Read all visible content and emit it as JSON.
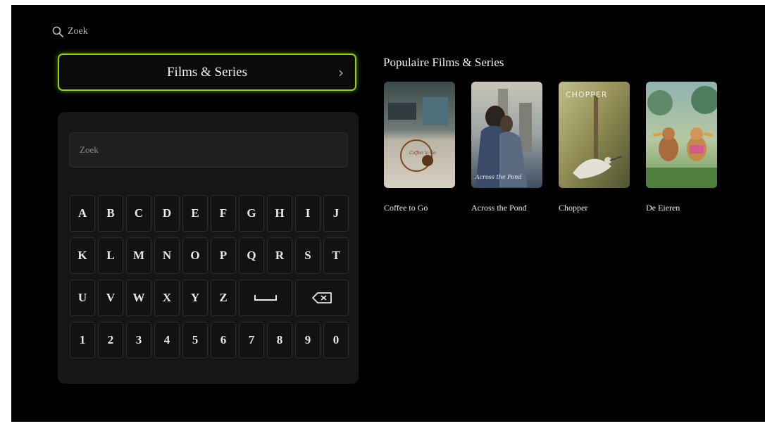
{
  "top_search": {
    "label": "Zoek"
  },
  "category": {
    "label": "Films & Series"
  },
  "keyboard": {
    "input_placeholder": "Zoek",
    "row1": [
      "A",
      "B",
      "C",
      "D",
      "E",
      "F",
      "G",
      "H",
      "I",
      "J"
    ],
    "row2": [
      "K",
      "L",
      "M",
      "N",
      "O",
      "P",
      "Q",
      "R",
      "S",
      "T"
    ],
    "row3": [
      "U",
      "V",
      "W",
      "X",
      "Y",
      "Z"
    ],
    "row4": [
      "1",
      "2",
      "3",
      "4",
      "5",
      "6",
      "7",
      "8",
      "9",
      "0"
    ]
  },
  "popular": {
    "title": "Populaire Films & Series",
    "items": [
      {
        "title": "Coffee to Go",
        "poster_text": "Coffee to Go",
        "icon": "coffee-poster"
      },
      {
        "title": "Across the Pond",
        "poster_text": "Across the Pond",
        "icon": "couple-poster"
      },
      {
        "title": "Chopper",
        "poster_text": "CHOPPER",
        "icon": "bird-poster"
      },
      {
        "title": "De Eieren",
        "poster_text": "",
        "icon": "ducks-poster"
      }
    ]
  },
  "colors": {
    "focus": "#8fd400",
    "background": "#000000",
    "panel": "#161616"
  }
}
